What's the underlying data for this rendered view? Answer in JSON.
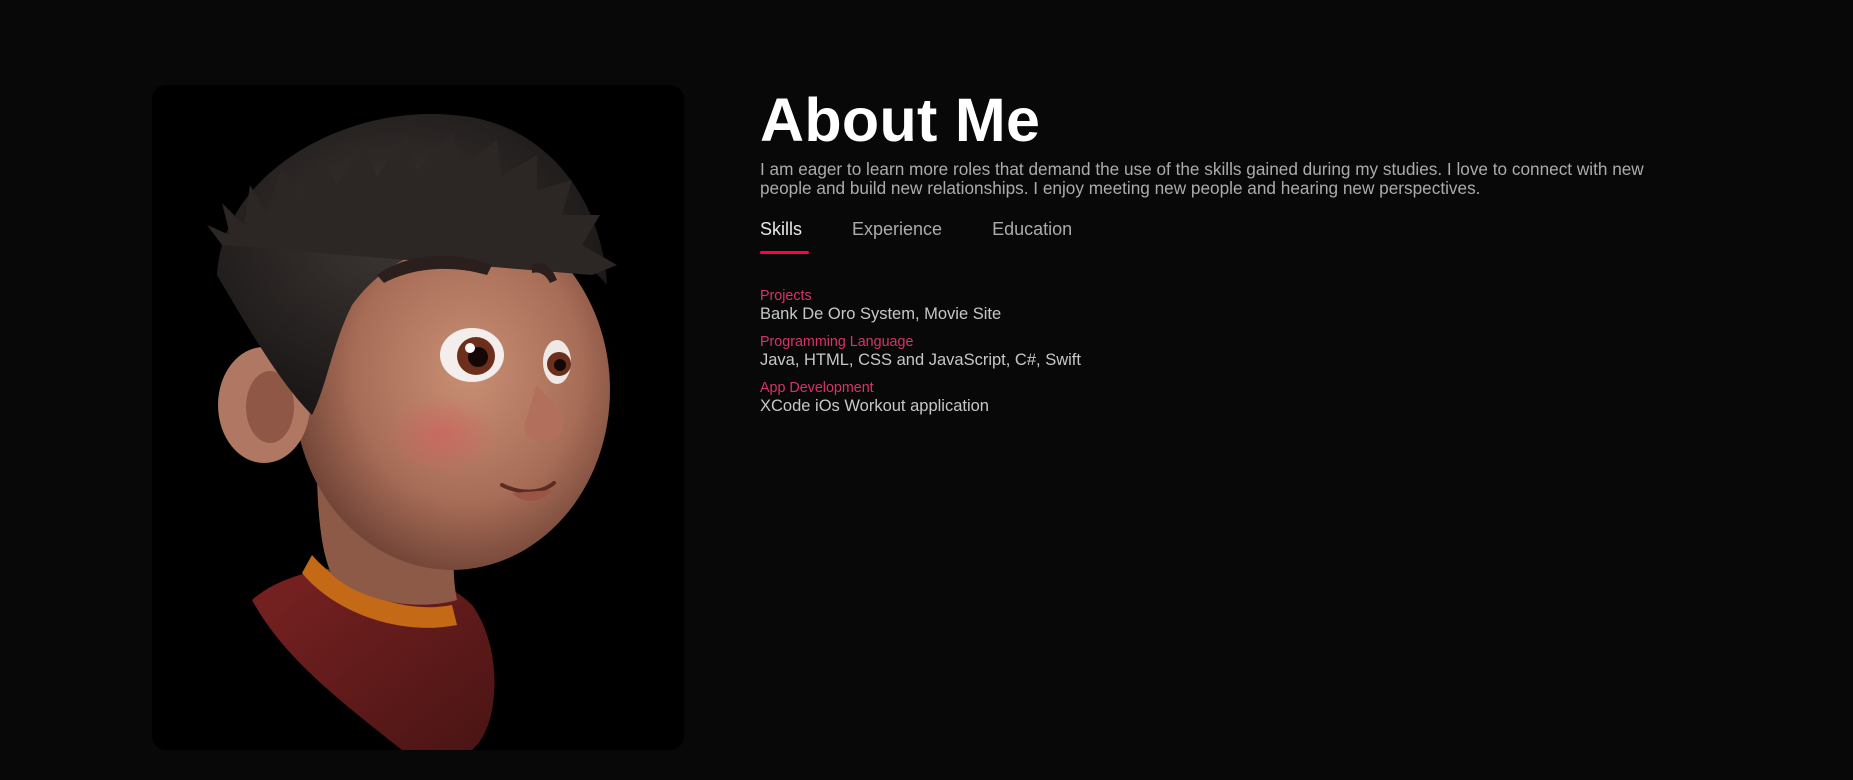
{
  "about": {
    "title": "About Me",
    "intro": "I am eager to learn more roles that demand the use of the skills gained during my studies. I love to connect with new people and build new relationships. I enjoy meeting new people and hearing new perspectives.",
    "portrait_icon": "cartoon-boy-portrait"
  },
  "tabs": [
    {
      "label": "Skills",
      "active": true
    },
    {
      "label": "Experience",
      "active": false
    },
    {
      "label": "Education",
      "active": false
    }
  ],
  "skills": [
    {
      "heading": "Projects",
      "value": "Bank De Oro System, Movie Site"
    },
    {
      "heading": "Programming Language",
      "value": "Java, HTML, CSS and JavaScript, C#, Swift"
    },
    {
      "heading": "App Development",
      "value": "XCode iOs Workout application"
    }
  ],
  "colors": {
    "background": "#080808",
    "accent": "#ff004f",
    "skill_heading": "#d6336c",
    "text": "#ababab"
  }
}
